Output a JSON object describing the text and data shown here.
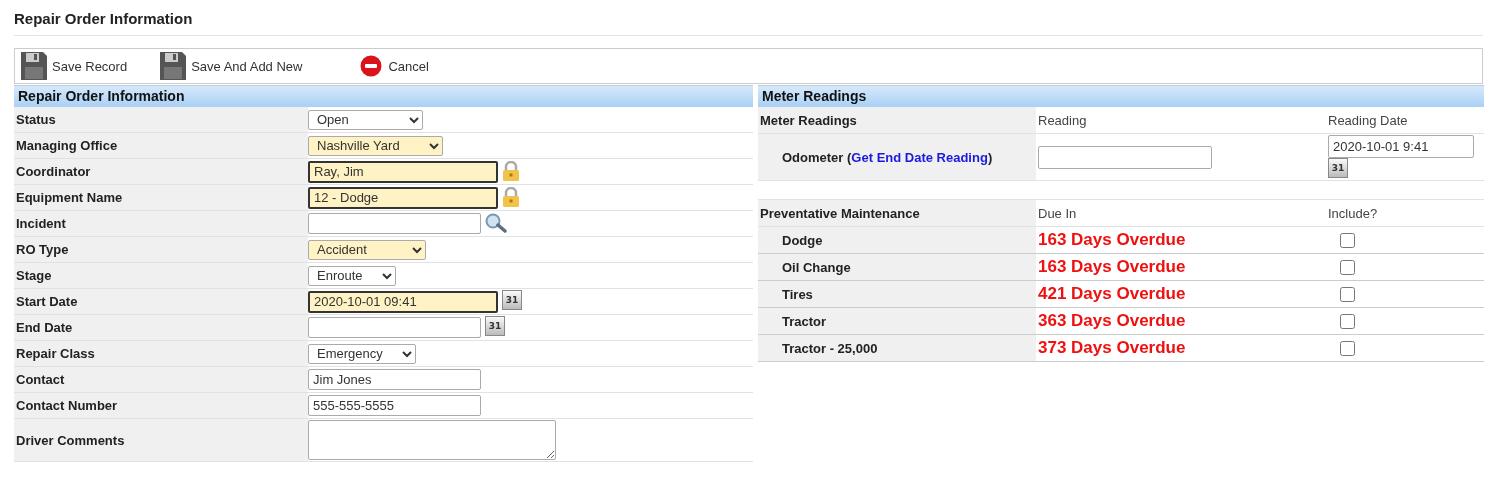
{
  "page_title": "Repair Order Information",
  "toolbar": [
    {
      "label": "Save Record",
      "kind": "save"
    },
    {
      "label": "Save And Add New",
      "kind": "save"
    },
    {
      "label": "Cancel",
      "kind": "cancel"
    }
  ],
  "repair_order": {
    "title": "Repair Order Information",
    "fields": [
      {
        "label": "Status",
        "kind": "select",
        "value": "Open",
        "required": false
      },
      {
        "label": "Managing Office",
        "kind": "select",
        "value": "Nashville Yard",
        "required": true
      },
      {
        "label": "Coordinator",
        "kind": "locked",
        "value": "Ray, Jim",
        "required": true
      },
      {
        "label": "Equipment Name",
        "kind": "locked",
        "value": "12 - Dodge",
        "required": true
      },
      {
        "label": "Incident",
        "kind": "lookup",
        "required": false
      },
      {
        "label": "RO Type",
        "kind": "select",
        "value": "Accident",
        "required": true
      },
      {
        "label": "Stage",
        "kind": "select",
        "value": "Enroute",
        "required": false
      },
      {
        "label": "Start Date",
        "kind": "date",
        "value": "2020-10-01 09:41",
        "required": true,
        "calendar": "31"
      },
      {
        "label": "End Date",
        "kind": "date",
        "required": false,
        "calendar": "31"
      },
      {
        "label": "Repair Class",
        "kind": "select",
        "value": "Emergency",
        "required": false
      },
      {
        "label": "Contact",
        "kind": "text",
        "value": "Jim Jones",
        "required": false
      },
      {
        "label": "Contact Number",
        "kind": "text",
        "value": "555-555-5555",
        "required": false
      },
      {
        "label": "Driver Comments",
        "kind": "textarea",
        "required": false
      }
    ]
  },
  "meter_readings": {
    "title": "Meter Readings",
    "header": [
      "Meter Readings",
      "Reading",
      "Reading Date"
    ],
    "rows": [
      {
        "prefix": "Odometer (",
        "link": "Get End Date Reading",
        "suffix": ")",
        "date": "2020-10-01 9:41",
        "calendar": "31"
      }
    ]
  },
  "maintenance": {
    "header": [
      "Preventative Maintenance",
      "Due In",
      "Include?"
    ],
    "rows": [
      {
        "name": "Dodge",
        "due": "163 Days Overdue",
        "include": false
      },
      {
        "name": "Oil Change",
        "due": "163 Days Overdue",
        "include": false
      },
      {
        "name": "Tires",
        "due": "421 Days Overdue",
        "include": false
      },
      {
        "name": "Tractor",
        "due": "363 Days Overdue",
        "include": false
      },
      {
        "name": "Tractor - 25,000",
        "due": "373 Days Overdue",
        "include": false
      }
    ]
  }
}
